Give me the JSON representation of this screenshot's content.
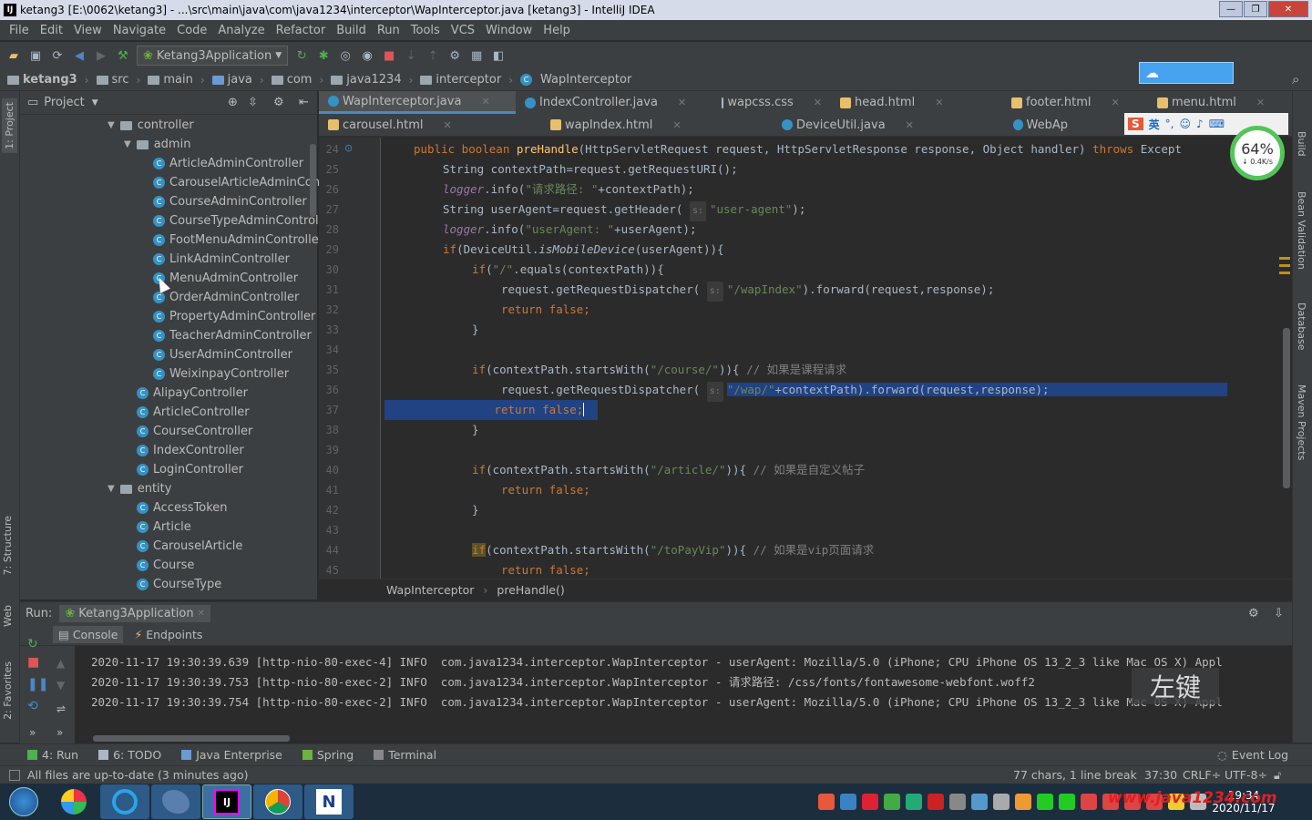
{
  "window": {
    "title": "ketang3 [E:\\0062\\ketang3] - ...\\src\\main\\java\\com\\java1234\\interceptor\\WapInterceptor.java [ketang3] - IntelliJ IDEA",
    "minimize": "—",
    "maximize": "❐",
    "close": "✕"
  },
  "menu": [
    "File",
    "Edit",
    "View",
    "Navigate",
    "Code",
    "Analyze",
    "Refactor",
    "Build",
    "Run",
    "Tools",
    "VCS",
    "Window",
    "Help"
  ],
  "toolbar": {
    "run_config": "Ketang3Application"
  },
  "nav": {
    "crumbs": [
      "ketang3",
      "src",
      "main",
      "java",
      "com",
      "java1234",
      "interceptor",
      "WapInterceptor"
    ]
  },
  "left_tabs": {
    "project": "1: Project",
    "structure": "7: Structure",
    "web": "Web",
    "favorites": "2: Favorites"
  },
  "right_tabs": {
    "build": "Build",
    "bean": "Bean Validation",
    "database": "Database",
    "maven": "Maven Projects"
  },
  "project": {
    "header": "Project",
    "tree": [
      {
        "label": "controller",
        "type": "folder",
        "depth": 0,
        "expanded": true
      },
      {
        "label": "admin",
        "type": "folder",
        "depth": 1,
        "expanded": true
      },
      {
        "label": "ArticleAdminController",
        "type": "class",
        "depth": 2
      },
      {
        "label": "CarouselArticleAdminContro",
        "type": "class",
        "depth": 2
      },
      {
        "label": "CourseAdminController",
        "type": "class",
        "depth": 2
      },
      {
        "label": "CourseTypeAdminController",
        "type": "class",
        "depth": 2
      },
      {
        "label": "FootMenuAdminController",
        "type": "class",
        "depth": 2
      },
      {
        "label": "LinkAdminController",
        "type": "class",
        "depth": 2
      },
      {
        "label": "MenuAdminController",
        "type": "class",
        "depth": 2
      },
      {
        "label": "OrderAdminController",
        "type": "class",
        "depth": 2
      },
      {
        "label": "PropertyAdminController",
        "type": "class",
        "depth": 2
      },
      {
        "label": "TeacherAdminController",
        "type": "class",
        "depth": 2
      },
      {
        "label": "UserAdminController",
        "type": "class",
        "depth": 2
      },
      {
        "label": "WeixinpayController",
        "type": "class",
        "depth": 2
      },
      {
        "label": "AlipayController",
        "type": "class",
        "depth": 1
      },
      {
        "label": "ArticleController",
        "type": "class",
        "depth": 1
      },
      {
        "label": "CourseController",
        "type": "class",
        "depth": 1
      },
      {
        "label": "IndexController",
        "type": "class",
        "depth": 1
      },
      {
        "label": "LoginController",
        "type": "class",
        "depth": 1
      },
      {
        "label": "entity",
        "type": "folder",
        "depth": 0,
        "expanded": true
      },
      {
        "label": "AccessToken",
        "type": "class",
        "depth": 1
      },
      {
        "label": "Article",
        "type": "class",
        "depth": 1
      },
      {
        "label": "CarouselArticle",
        "type": "class",
        "depth": 1
      },
      {
        "label": "Course",
        "type": "class",
        "depth": 1
      },
      {
        "label": "CourseType",
        "type": "class",
        "depth": 1
      }
    ]
  },
  "editor": {
    "tabs_row1": [
      {
        "label": "WapInterceptor.java",
        "icon": "#3592c4",
        "active": true
      },
      {
        "label": "IndexController.java",
        "icon": "#3592c4",
        "active": false
      },
      {
        "label": "wapcss.css",
        "icon": "#a9b7c6",
        "active": false
      },
      {
        "label": "head.html",
        "icon": "#e8bf6a",
        "active": false
      },
      {
        "label": "footer.html",
        "icon": "#e8bf6a",
        "active": false
      },
      {
        "label": "menu.html",
        "icon": "#e8bf6a",
        "active": false
      }
    ],
    "tabs_row2": [
      {
        "label": "carousel.html",
        "icon": "#e8bf6a"
      },
      {
        "label": "wapIndex.html",
        "icon": "#e8bf6a"
      },
      {
        "label": "DeviceUtil.java",
        "icon": "#3592c4"
      },
      {
        "label": "WebAp",
        "icon": "#3592c4"
      }
    ],
    "line_numbers": [
      "24",
      "25",
      "26",
      "27",
      "28",
      "29",
      "30",
      "31",
      "32",
      "33",
      "34",
      "35",
      "36",
      "37",
      "38",
      "39",
      "40",
      "41",
      "42",
      "43",
      "44",
      "45"
    ],
    "breadcrumb": [
      "WapInterceptor",
      "preHandle()"
    ]
  },
  "ime": {
    "lang": "英",
    "speed_pct": "64%",
    "speed_rate": "↓ 0.4K/s"
  },
  "run": {
    "label": "Run:",
    "config": "Ketang3Application",
    "console_tab": "Console",
    "endpoints_tab": "Endpoints",
    "logs": [
      "2020-11-17 19:30:39.639 [http-nio-80-exec-4] INFO  com.java1234.interceptor.WapInterceptor - userAgent: Mozilla/5.0 (iPhone; CPU iPhone OS 13_2_3 like Mac OS X) Appl",
      "2020-11-17 19:30:39.753 [http-nio-80-exec-2] INFO  com.java1234.interceptor.WapInterceptor - 请求路径: /css/fonts/fontawesome-webfont.woff2",
      "2020-11-17 19:30:39.754 [http-nio-80-exec-2] INFO  com.java1234.interceptor.WapInterceptor - userAgent: Mozilla/5.0 (iPhone; CPU iPhone OS 13_2_3 like Mac OS X) Appl"
    ],
    "overlay_text": "左键"
  },
  "bottom_tools": [
    {
      "label": "4: Run",
      "icon": "#4eb04e"
    },
    {
      "label": "6: TODO",
      "icon": "#a9b7c6"
    },
    {
      "label": "Java Enterprise",
      "icon": "#6b9bd1"
    },
    {
      "label": "Spring",
      "icon": "#6db33f"
    },
    {
      "label": "Terminal",
      "icon": "#888888"
    }
  ],
  "event_log": "Event Log",
  "status": {
    "message": "All files are up-to-date (3 minutes ago)",
    "selection": "77 chars, 1 line break",
    "position": "37:30",
    "line_sep": "CRLF÷",
    "encoding": "UTF-8÷"
  },
  "taskbar": {
    "time": "19:34",
    "date": "2020/11/17",
    "watermark": "www.java1234.com"
  }
}
